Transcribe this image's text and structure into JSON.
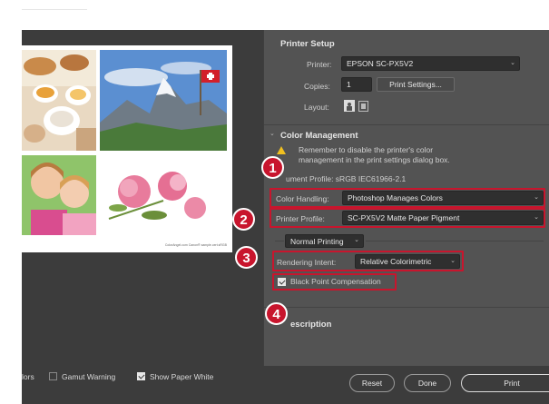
{
  "printer_setup": {
    "title": "Printer Setup",
    "printer_label": "Printer:",
    "printer_value": "EPSON SC-PX5V2",
    "copies_label": "Copies:",
    "copies_value": "1",
    "print_settings_button": "Print Settings...",
    "layout_label": "Layout:"
  },
  "color_management": {
    "title": "Color Management",
    "warning_line1": "Remember to disable the printer's color",
    "warning_line2": "management in the print settings dialog box.",
    "document_profile": "ument Profile: sRGB IEC61966-2.1",
    "color_handling_label": "Color Handling:",
    "color_handling_value": "Photoshop Manages Colors",
    "printer_profile_label": "Printer Profile:",
    "printer_profile_value": "SC-PX5V2 Matte Paper Pigment",
    "normal_printing_value": "Normal Printing",
    "rendering_intent_label": "Rendering Intent:",
    "rendering_intent_value": "Relative Colorimetric",
    "black_point_label": "Black Point Compensation",
    "black_point_checked": true
  },
  "description": {
    "title": "escription"
  },
  "callouts": [
    "1",
    "2",
    "3",
    "4"
  ],
  "bottom": {
    "colors_partial": "lors",
    "gamut_warning_label": "Gamut Warning",
    "gamut_warning_checked": false,
    "show_paper_white_label": "Show Paper White",
    "show_paper_white_checked": true,
    "reset_button": "Reset",
    "done_button": "Done",
    "print_button": "Print"
  },
  "preview": {
    "caption": "ColorAngel.com Canon® sample.cert.sRGB"
  },
  "colors": {
    "accent": "#c8152d",
    "panel": "#535353",
    "dark": "#3c3c3c",
    "warning": "#f0c020"
  },
  "icons": {
    "layout_portrait": "portrait-layout-icon",
    "layout_landscape": "landscape-layout-icon",
    "warning": "warning-icon",
    "collapse": "chevron-down-icon"
  }
}
